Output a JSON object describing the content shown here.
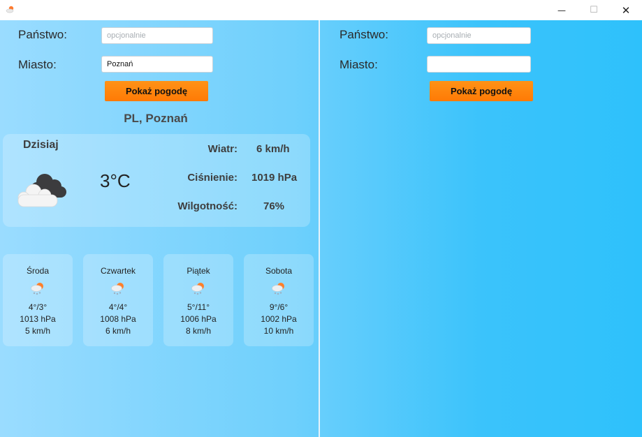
{
  "window": {
    "minimize_glyph": "—",
    "maximize_glyph": "☐",
    "close_glyph": "✕"
  },
  "left_panel": {
    "country_label": "Państwo:",
    "country_placeholder": "opcjonalnie",
    "country_value": "",
    "city_label": "Miasto:",
    "city_value": "Poznań",
    "button_label": "Pokaż pogodę",
    "location": "PL, Poznań",
    "today": {
      "title": "Dzisiaj",
      "icon": "cloudy-icon",
      "temperature": "3°C",
      "wind_label": "Wiatr:",
      "wind_value": "6 km/h",
      "pressure_label": "Ciśnienie:",
      "pressure_value": "1019 hPa",
      "humidity_label": "Wilgotność:",
      "humidity_value": "76%"
    },
    "forecast": [
      {
        "day": "Środa",
        "icon": "snow-sun-icon",
        "temp": "4°/3°",
        "pressure": "1013 hPa",
        "wind": "5 km/h"
      },
      {
        "day": "Czwartek",
        "icon": "snow-sun-icon",
        "temp": "4°/4°",
        "pressure": "1008 hPa",
        "wind": "6 km/h"
      },
      {
        "day": "Piątek",
        "icon": "snow-sun-icon",
        "temp": "5°/11°",
        "pressure": "1006 hPa",
        "wind": "8 km/h"
      },
      {
        "day": "Sobota",
        "icon": "snow-sun-icon",
        "temp": "9°/6°",
        "pressure": "1002 hPa",
        "wind": "10 km/h"
      }
    ]
  },
  "right_panel": {
    "country_label": "Państwo:",
    "country_placeholder": "opcjonalnie",
    "country_value": "",
    "city_label": "Miasto:",
    "city_value": "",
    "button_label": "Pokaż pogodę"
  },
  "colors": {
    "background_start": "#9adcff",
    "background_end": "#2ec1fb",
    "button": "#ff8a10"
  }
}
